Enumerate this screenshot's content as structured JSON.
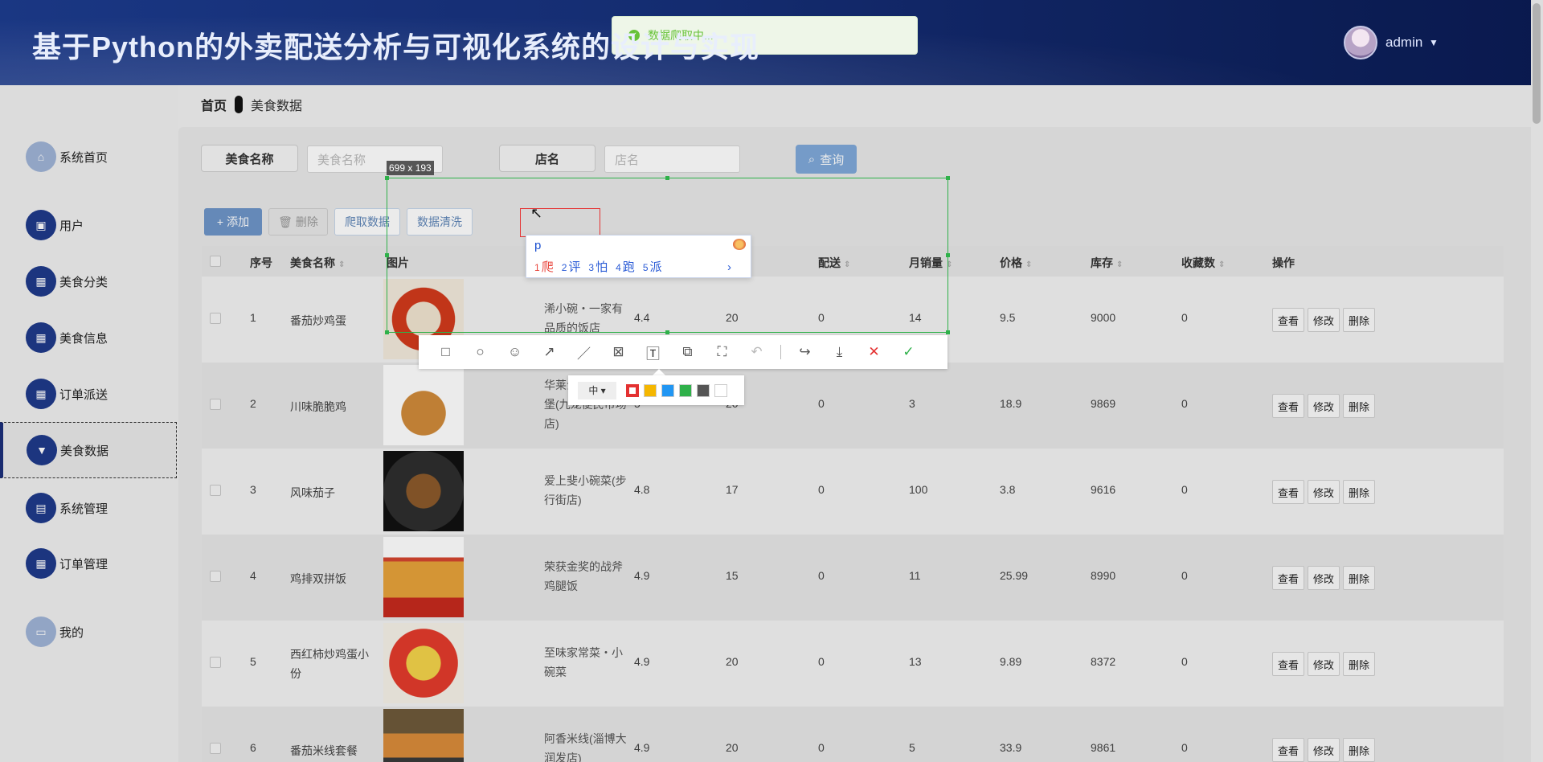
{
  "header": {
    "title": "基于Python的外卖配送分析与可视化系统的设计与实现",
    "user": "admin"
  },
  "breadcrumb": {
    "home": "首页",
    "current": "美食数据"
  },
  "sidebar": {
    "items": [
      {
        "label": "系统首页",
        "icon": "home-icon"
      },
      {
        "label": "用户",
        "icon": "user-icon"
      },
      {
        "label": "美食分类",
        "icon": "grid-icon"
      },
      {
        "label": "美食信息",
        "icon": "grid-icon"
      },
      {
        "label": "订单派送",
        "icon": "grid-icon"
      },
      {
        "label": "美食数据",
        "icon": "data-icon"
      },
      {
        "label": "系统管理",
        "icon": "table-icon"
      },
      {
        "label": "订单管理",
        "icon": "grid-icon"
      },
      {
        "label": "我的",
        "icon": "card-icon"
      }
    ],
    "active": "美食数据"
  },
  "search": {
    "food_label": "美食名称",
    "food_placeholder": "美食名称",
    "shop_label": "店名",
    "shop_placeholder": "店名",
    "button": "查询"
  },
  "actions": {
    "add": "添加",
    "delete": "删除",
    "crawl": "爬取数据",
    "clean": "数据清洗"
  },
  "table": {
    "headers": {
      "index": "序号",
      "name": "美食名称",
      "image": "图片",
      "delivery": "配送",
      "monthly_sales": "月销量",
      "price": "价格",
      "stock": "库存",
      "favorites": "收藏数",
      "operation": "操作"
    },
    "row_actions": {
      "view": "查看",
      "edit": "修改",
      "delete": "删除"
    },
    "rows": [
      {
        "index": "1",
        "name": "番茄炒鸡蛋",
        "shop": "浠小碗・一家有品质的饭店",
        "rating": "4.4",
        "time": "20",
        "delivery": "0",
        "monthly_sales": "14",
        "price": "9.5",
        "stock": "9000",
        "favorites": "0"
      },
      {
        "index": "2",
        "name": "川味脆脆鸡",
        "shop": "华莱士・全鸡汉堡(九龙便民市场店)",
        "rating": "5",
        "time": "20",
        "delivery": "0",
        "monthly_sales": "3",
        "price": "18.9",
        "stock": "9869",
        "favorites": "0"
      },
      {
        "index": "3",
        "name": "风味茄子",
        "shop": "爱上斐小碗菜(步行街店)",
        "rating": "4.8",
        "time": "17",
        "delivery": "0",
        "monthly_sales": "100",
        "price": "3.8",
        "stock": "9616",
        "favorites": "0"
      },
      {
        "index": "4",
        "name": "鸡排双拼饭",
        "shop": "荣获金奖的战斧鸡腿饭",
        "rating": "4.9",
        "time": "15",
        "delivery": "0",
        "monthly_sales": "11",
        "price": "25.99",
        "stock": "8990",
        "favorites": "0"
      },
      {
        "index": "5",
        "name": "西红柿炒鸡蛋小份",
        "shop": "至味家常菜・小碗菜",
        "rating": "4.9",
        "time": "20",
        "delivery": "0",
        "monthly_sales": "13",
        "price": "9.89",
        "stock": "8372",
        "favorites": "0"
      },
      {
        "index": "6",
        "name": "番茄米线套餐",
        "shop": "阿香米线(淄博大润发店)",
        "rating": "4.9",
        "time": "20",
        "delivery": "0",
        "monthly_sales": "5",
        "price": "33.9",
        "stock": "9861",
        "favorites": "0"
      }
    ]
  },
  "toast": {
    "message": "数据爬取中..."
  },
  "screenshot_tool": {
    "size_label": "699 x 193",
    "ime_input": "p",
    "ime_candidates": [
      {
        "num": "1",
        "text": "爬"
      },
      {
        "num": "2",
        "text": "评"
      },
      {
        "num": "3",
        "text": "怕"
      },
      {
        "num": "4",
        "text": "跑"
      },
      {
        "num": "5",
        "text": "派"
      }
    ],
    "font_size": "中",
    "colors": [
      "#e43131",
      "#f5b700",
      "#2196f3",
      "#2fb14a",
      "#555555",
      "#ffffff"
    ]
  }
}
